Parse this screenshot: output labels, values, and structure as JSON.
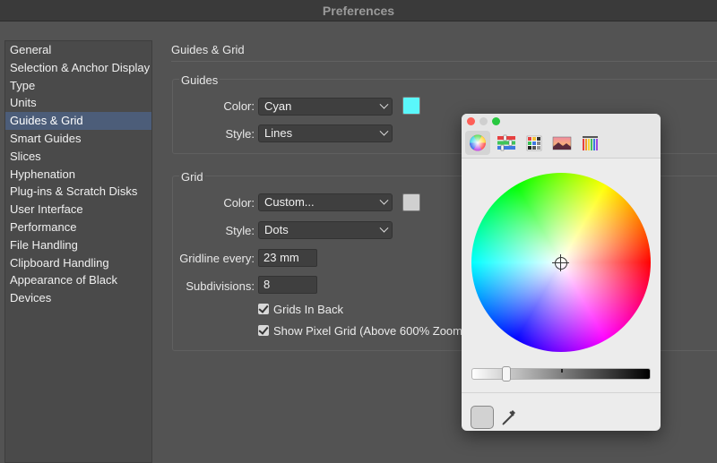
{
  "window": {
    "title": "Preferences"
  },
  "sidebar": {
    "items": [
      {
        "label": "General"
      },
      {
        "label": "Selection & Anchor Display"
      },
      {
        "label": "Type"
      },
      {
        "label": "Units"
      },
      {
        "label": "Guides & Grid",
        "selected": true
      },
      {
        "label": "Smart Guides"
      },
      {
        "label": "Slices"
      },
      {
        "label": "Hyphenation"
      },
      {
        "label": "Plug-ins & Scratch Disks"
      },
      {
        "label": "User Interface"
      },
      {
        "label": "Performance"
      },
      {
        "label": "File Handling"
      },
      {
        "label": "Clipboard Handling"
      },
      {
        "label": "Appearance of Black"
      },
      {
        "label": "Devices"
      }
    ]
  },
  "panel": {
    "title": "Guides & Grid",
    "guides": {
      "heading": "Guides",
      "color_label": "Color:",
      "color_value": "Cyan",
      "color_swatch": "#5af7fb",
      "style_label": "Style:",
      "style_value": "Lines"
    },
    "grid": {
      "heading": "Grid",
      "color_label": "Color:",
      "color_value": "Custom...",
      "color_swatch": "#d0d0d0",
      "style_label": "Style:",
      "style_value": "Dots",
      "gridline_label": "Gridline every:",
      "gridline_value": "23 mm",
      "subdivisions_label": "Subdivisions:",
      "subdivisions_value": "8",
      "grids_in_back": {
        "label": "Grids In Back",
        "checked": true
      },
      "pixel_grid": {
        "label": "Show Pixel Grid (Above 600% Zoom)",
        "checked": true
      }
    }
  },
  "color_picker": {
    "toolbar": [
      "color-wheel-icon",
      "sliders-icon",
      "palettes-icon",
      "image-palettes-icon",
      "pencils-icon"
    ],
    "active_tab": "color-wheel-icon",
    "brightness": 0.2,
    "current_color": "#d2d2d2"
  }
}
